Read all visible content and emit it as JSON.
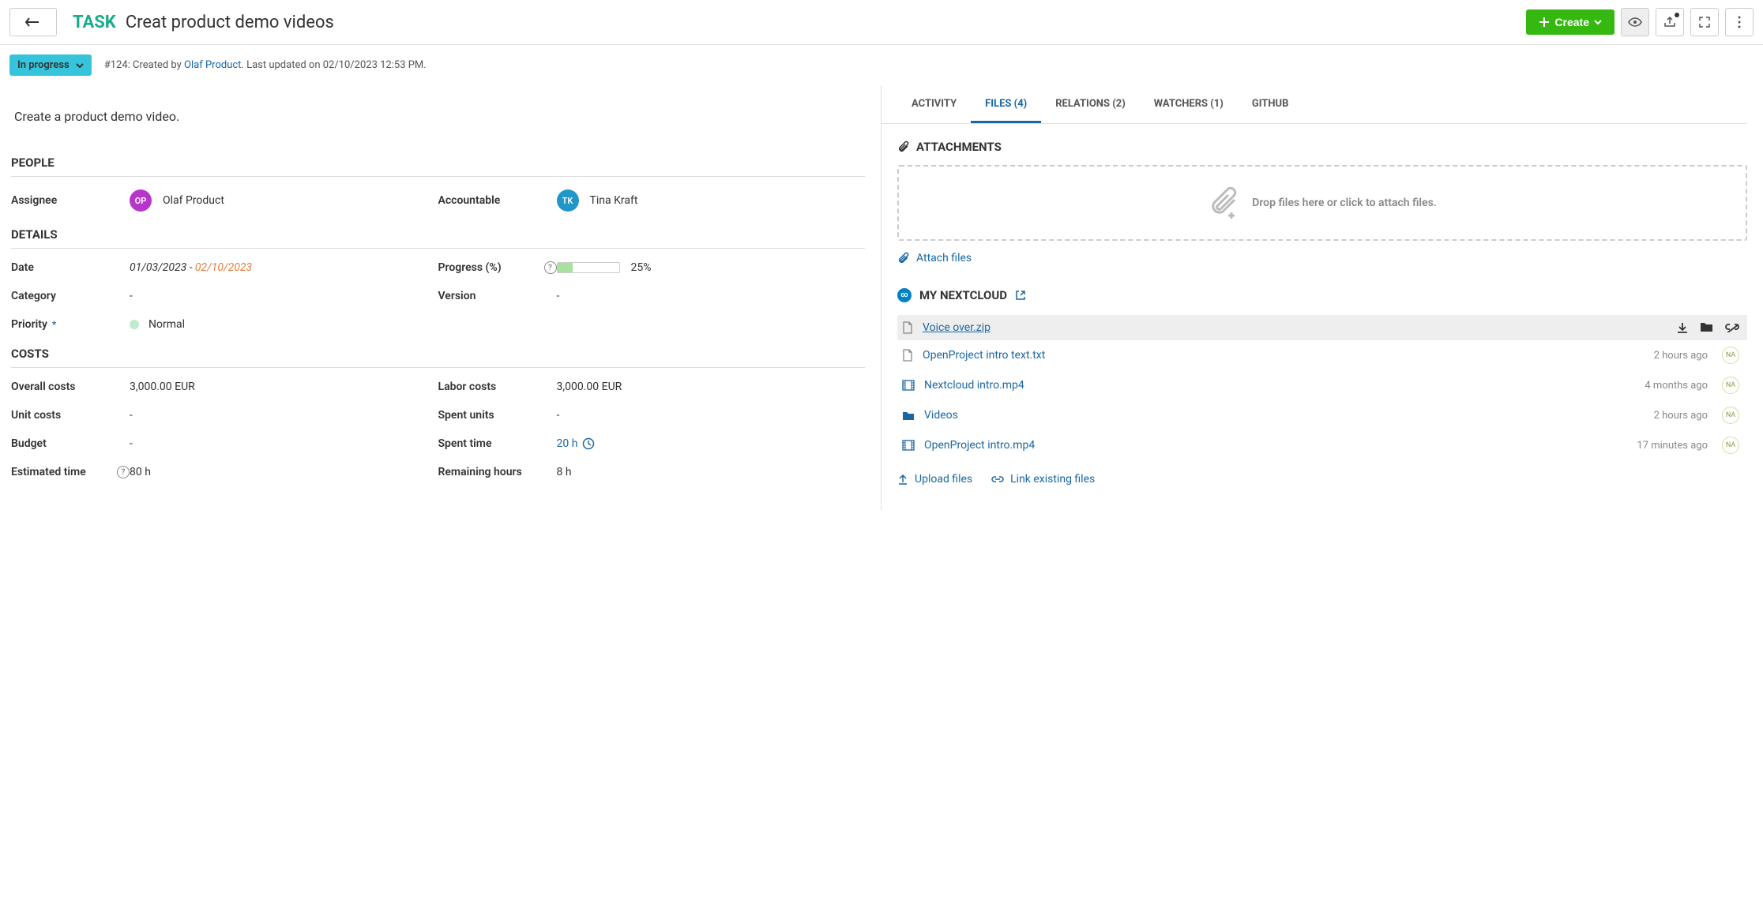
{
  "header": {
    "task_type": "TASK",
    "title": "Creat product demo videos",
    "create_label": "Create"
  },
  "meta": {
    "status": "In progress",
    "id_prefix": "#124: Created by ",
    "author": "Olaf Product",
    "updated_suffix": ". Last updated on 02/10/2023 12:53 PM."
  },
  "description": "Create a product demo video.",
  "sections": {
    "people": "PEOPLE",
    "details": "DETAILS",
    "costs": "COSTS"
  },
  "people": {
    "assignee_label": "Assignee",
    "assignee_initials": "OP",
    "assignee_name": "Olaf Product",
    "accountable_label": "Accountable",
    "accountable_initials": "TK",
    "accountable_name": "Tina Kraft"
  },
  "details": {
    "date_label": "Date",
    "date_start": "01/03/2023",
    "date_sep": " - ",
    "date_end": "02/10/2023",
    "progress_label": "Progress (%)",
    "progress_pct": 25,
    "progress_text": "25%",
    "category_label": "Category",
    "category_value": "-",
    "version_label": "Version",
    "version_value": "-",
    "priority_label": "Priority",
    "priority_value": "Normal"
  },
  "costs": {
    "overall_label": "Overall costs",
    "overall_value": "3,000.00 EUR",
    "labor_label": "Labor costs",
    "labor_value": "3,000.00 EUR",
    "unit_label": "Unit costs",
    "unit_value": "-",
    "spent_units_label": "Spent units",
    "spent_units_value": "-",
    "budget_label": "Budget",
    "budget_value": "-",
    "spent_time_label": "Spent time",
    "spent_time_value": "20 h",
    "estimated_label": "Estimated time",
    "estimated_value": "80 h",
    "remaining_label": "Remaining hours",
    "remaining_value": "8 h"
  },
  "tabs": {
    "activity": "ACTIVITY",
    "files": "FILES (4)",
    "relations": "RELATIONS (2)",
    "watchers": "WATCHERS (1)",
    "github": "GITHUB"
  },
  "attachments": {
    "heading": "ATTACHMENTS",
    "drop_text": "Drop files here or click to attach files.",
    "attach_link": "Attach files"
  },
  "nextcloud": {
    "heading": "MY NEXTCLOUD",
    "upload_label": "Upload files",
    "link_label": "Link existing files",
    "files": [
      {
        "name": "Voice over.zip",
        "time": "",
        "icon": "file",
        "hover": true
      },
      {
        "name": "OpenProject intro text.txt",
        "time": "2 hours ago",
        "icon": "file",
        "hover": false
      },
      {
        "name": "Nextcloud intro.mp4",
        "time": "4 months ago",
        "icon": "video",
        "hover": false
      },
      {
        "name": "Videos",
        "time": "2 hours ago",
        "icon": "folder",
        "hover": false
      },
      {
        "name": "OpenProject intro.mp4",
        "time": "17 minutes ago",
        "icon": "video",
        "hover": false
      }
    ]
  }
}
